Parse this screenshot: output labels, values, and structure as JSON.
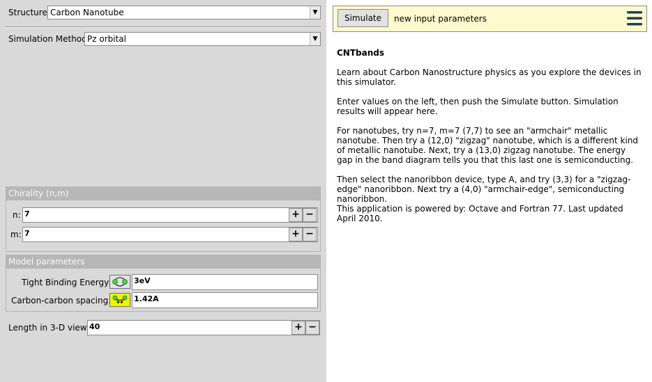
{
  "structure": {
    "label": "Structure:",
    "value": "Carbon Nanotube"
  },
  "method": {
    "label": "Simulation Method:",
    "value": "Pz orbital"
  },
  "chirality": {
    "title": "Chirality (n,m)",
    "n_label": "n:",
    "n_value": "7",
    "m_label": "m:",
    "m_value": "7",
    "plus": "+",
    "minus": "−"
  },
  "model": {
    "title": "Model parameters",
    "tb_label": "Tight Binding Energy:",
    "tb_value": "3eV",
    "cc_label": "Carbon-carbon spacing:",
    "cc_value": "1.42A"
  },
  "length": {
    "label": "Length in 3-D view:",
    "value": "40"
  },
  "toolbar": {
    "simulate_label": "Simulate",
    "status": "new input parameters"
  },
  "info": {
    "title": "CNTbands",
    "p1": "Learn about Carbon Nanostructure physics as you explore the devices in this simulator.",
    "p2": "Enter values on the left, then push the Simulate button.  Simulation results will appear here.",
    "p3": "For nanotubes, try n=7, m=7 (7,7) to see an \"armchair\" metallic nanotube.  Then try a (12,0) \"zigzag\" nanotube, which is a different kind of metallic nanotube.  Next, try a (13,0) zigzag nanotube. The energy gap in the band diagram tells you that this last one is semiconducting.",
    "p4": "Then select the nanoribbon device, type A, and try (3,3) for a \"zigzag-edge\" nanoribbon.  Next try a (4,0) \"armchair-edge\", semiconducting nanoribbon.",
    "p5": "This application is powered by: Octave and Fortran 77. Last updated April 2010."
  },
  "colors": {
    "accent_panel": "#fffacd",
    "menu_icon": "#1f3f55",
    "swatch_green": "#4ccf4c",
    "swatch_yellow": "#f4f400"
  }
}
